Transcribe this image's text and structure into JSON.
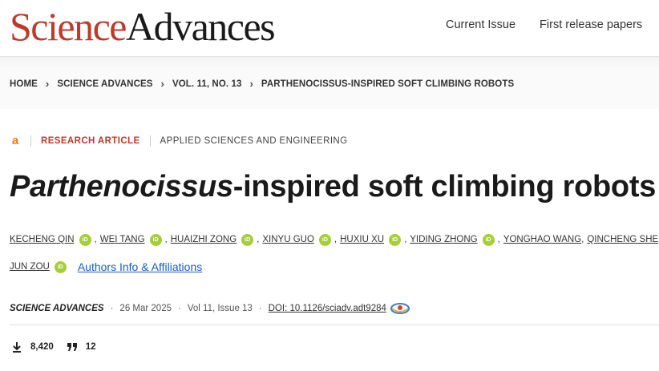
{
  "header": {
    "logo_science": "Science",
    "logo_advances": "Advances",
    "nav": [
      "Current Issue",
      "First release papers"
    ]
  },
  "breadcrumb": [
    "HOME",
    "SCIENCE ADVANCES",
    "VOL. 11, NO. 13",
    "PARTHENOCISSUS-INSPIRED SOFT CLIMBING ROBOTS"
  ],
  "article": {
    "type": "RESEARCH ARTICLE",
    "subject": "APPLIED SCIENCES AND ENGINEERING",
    "title_italic": "Parthenocissus",
    "title_rest": "-inspired soft climbing robots",
    "authors_row1": [
      "KECHENG QIN",
      "WEI TANG",
      "HUAIZHI ZONG",
      "XINYU GUO",
      "HUXIU XU",
      "YIDING ZHONG",
      "YONGHAO WANG",
      "QINCHENG SHE"
    ],
    "authors_row2": [
      "JUN ZOU"
    ],
    "orcid_label": "iD",
    "affiliations_link": "Authors Info & Affiliations",
    "journal": "SCIENCE ADVANCES",
    "date": "26 Mar 2025",
    "volume": "Vol 11, Issue 13",
    "doi": "DOI: 10.1126/sciadv.adt9284",
    "downloads": "8,420",
    "citations": "12"
  },
  "colors": {
    "brand_red": "#c0392b",
    "orcid_green": "#a6ce39",
    "link_blue": "#1a5bbf",
    "open_access_orange": "#e67e22"
  },
  "icons": [
    "open-access-icon",
    "orcid-icon",
    "crossmark-icon",
    "download-icon",
    "quote-icon",
    "chevron-right-icon"
  ]
}
